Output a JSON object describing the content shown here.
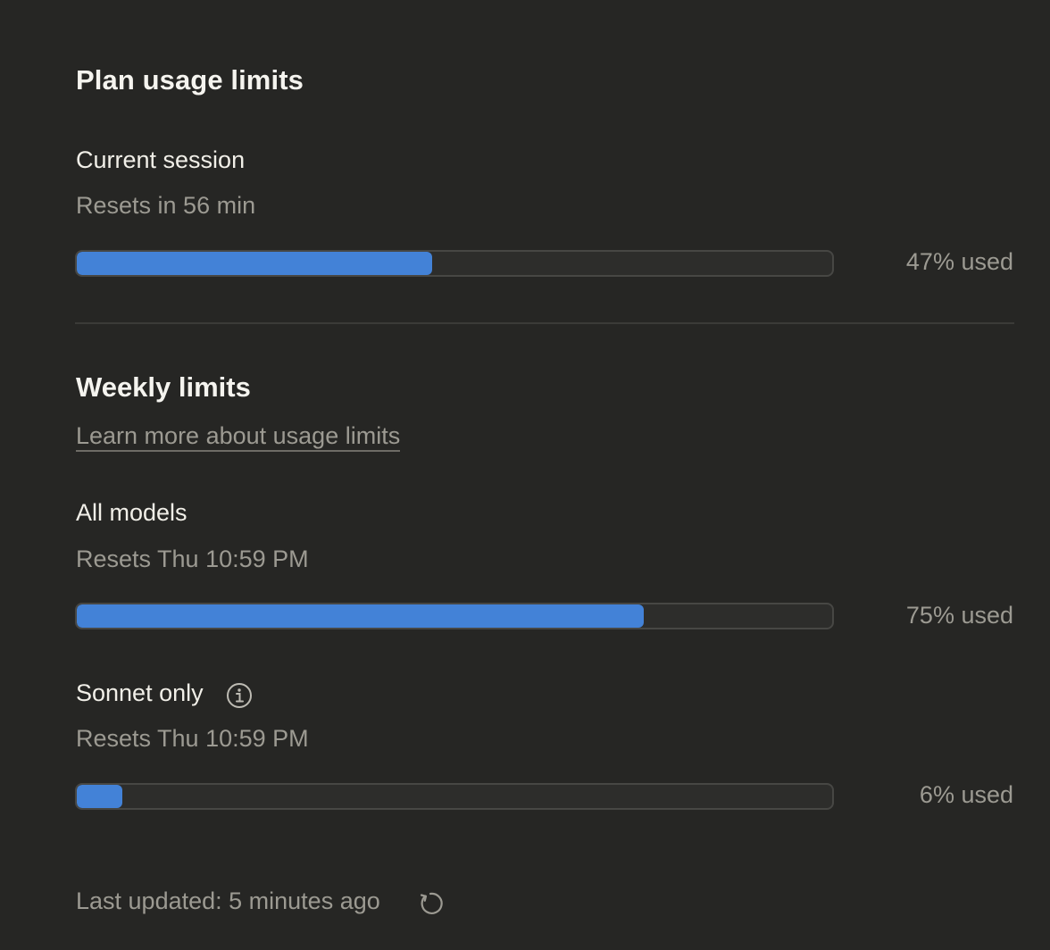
{
  "title": "Plan usage limits",
  "session": {
    "label": "Current session",
    "reset": "Resets in 56 min",
    "usage_fraction": 0.47,
    "percent_label": "47% used"
  },
  "weekly": {
    "title": "Weekly limits",
    "learn_more": "Learn more about usage limits",
    "all_models": {
      "label": "All models",
      "reset": "Resets Thu 10:59 PM",
      "usage_fraction": 0.75,
      "percent_label": "75% used"
    },
    "sonnet": {
      "label": "Sonnet only",
      "info_icon": "info-icon",
      "reset": "Resets Thu 10:59 PM",
      "usage_fraction": 0.06,
      "percent_label": "6% used"
    }
  },
  "footer": {
    "last_updated": "Last updated: 5 minutes ago",
    "refresh_icon": "refresh-icon"
  },
  "colors": {
    "background": "#262624",
    "bar_fill": "#4382d7",
    "bar_track": "#2d2d2b"
  }
}
